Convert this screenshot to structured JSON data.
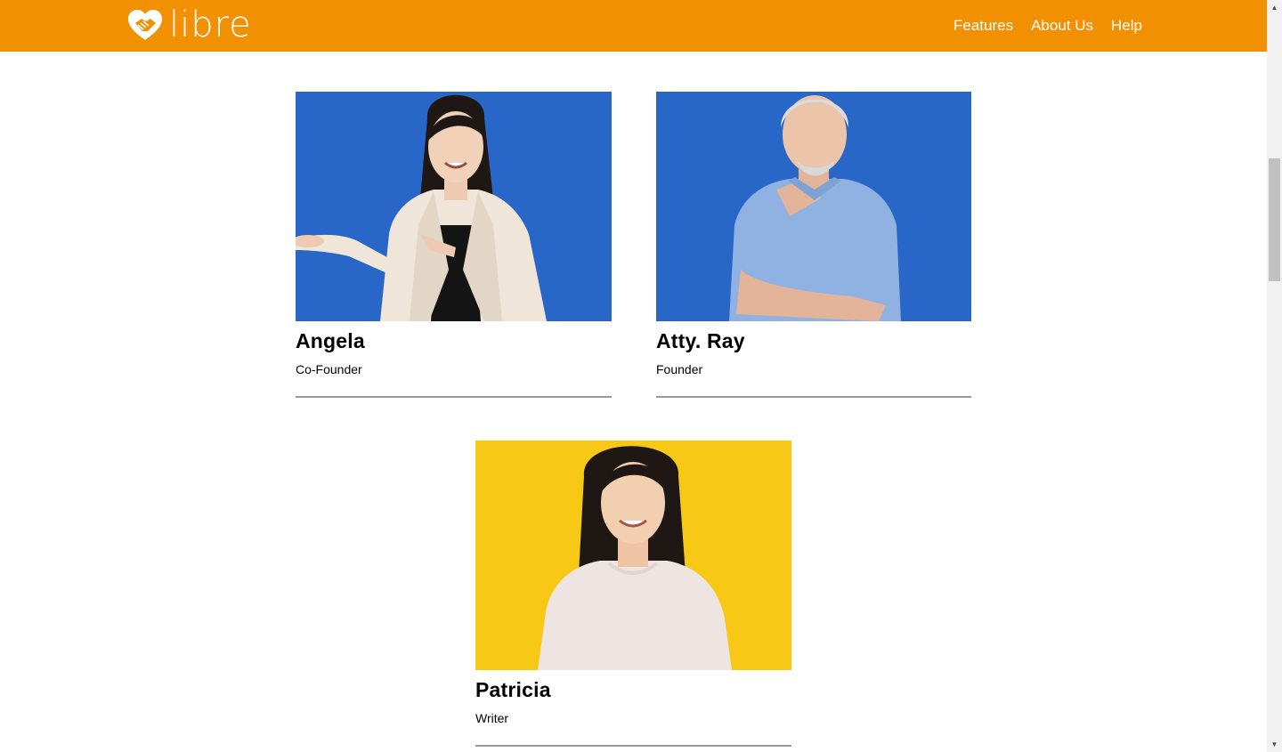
{
  "nav": {
    "brand": "libre",
    "links": [
      "Features",
      "About Us",
      "Help"
    ]
  },
  "team": [
    {
      "name": "Angela",
      "role": "Co-Founder",
      "bg": "#2867c7"
    },
    {
      "name": "Atty. Ray",
      "role": "Founder",
      "bg": "#2867c7"
    },
    {
      "name": "Patricia",
      "role": "Writer",
      "bg": "#f7c916"
    }
  ],
  "colors": {
    "navbar": "#f19000",
    "divider": "#9a9a9a"
  }
}
